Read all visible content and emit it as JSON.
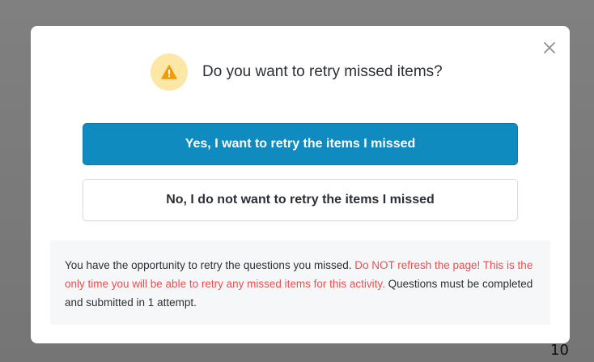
{
  "dialog": {
    "title": "Do you want to retry missed items?",
    "icon": "warning-icon",
    "close_icon": "close-icon",
    "yes_label": "Yes, I want to retry the items I missed",
    "no_label": "No, I do not want to retry the items I missed",
    "notice": {
      "part1": "You have the opportunity to retry the questions you missed. ",
      "warning": "Do NOT refresh the page! This is the only time you will be able to retry any missed items for this activity.",
      "part2": " Questions must be completed and submitted in 1 attempt."
    }
  },
  "page_number": "10",
  "colors": {
    "primary": "#0f8bbf",
    "warning_text": "#ef4d4d",
    "warning_icon_bg": "#fde7a6",
    "warning_icon": "#f29b0a"
  }
}
